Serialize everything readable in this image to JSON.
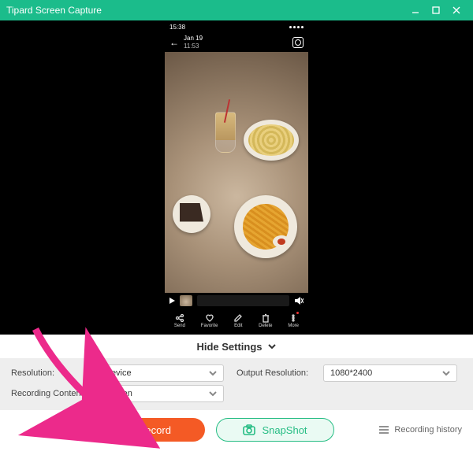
{
  "app": {
    "title": "Tipard Screen Capture"
  },
  "phone": {
    "time": "15:38",
    "date": "Jan 19",
    "subtime": "11:53",
    "tools": {
      "send": "Send",
      "favorite": "Favorite",
      "edit": "Edit",
      "delete": "Delete",
      "more": "More"
    }
  },
  "toggle": {
    "label": "Hide Settings"
  },
  "settings": {
    "resolution": {
      "label": "Resolution:",
      "value": "Device"
    },
    "content": {
      "label": "Recording Content:",
      "value": "Screen"
    },
    "output": {
      "label": "Output Resolution:",
      "value": "1080*2400"
    }
  },
  "actions": {
    "record": "Record",
    "snapshot": "SnapShot",
    "history": "Recording history"
  }
}
